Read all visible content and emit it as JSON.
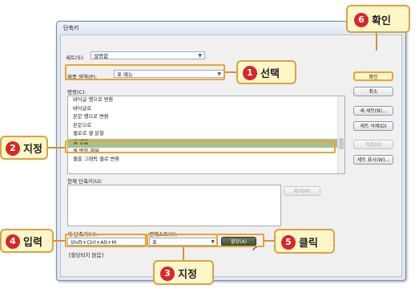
{
  "dialog": {
    "title": "단축키",
    "set_label": "세트(S):",
    "set_value": "설명합",
    "product_area_label": "제품 영역(P):",
    "product_area_value": "표 메뉴",
    "commands_label": "명령(C):",
    "commands": [
      "바닥글 행으로 변환",
      "바닥글로",
      "본문 행으로 변환",
      "본문으로",
      "셀로로 셀 분할",
      "셀 병합",
      "셀 병합 해제",
      "셀을 그래픽 셀로 변환"
    ],
    "selected_command_index": 5,
    "current_shortcut_label": "현재 단축키(U):",
    "remove_button": "제거(M)",
    "new_shortcut_label": "새 단축키(H):",
    "new_shortcut_value": "Shift+Ctrl+Alt+M",
    "context_label": "컨텍스트(X):",
    "context_value": "표",
    "assign_button": "할당(A)",
    "unassigned_text": "[할당되지 않음]",
    "buttons": {
      "ok": "확인",
      "cancel": "취소",
      "new_set": "새 세트(N)...",
      "delete_set": "세트 삭제(D)",
      "save": "저장(V)",
      "show_set": "세트 표시(W)..."
    }
  },
  "callouts": [
    {
      "num": "1",
      "text": "선택"
    },
    {
      "num": "2",
      "text": "지정"
    },
    {
      "num": "3",
      "text": "지정"
    },
    {
      "num": "4",
      "text": "입력"
    },
    {
      "num": "5",
      "text": "클릭"
    },
    {
      "num": "6",
      "text": "확인"
    }
  ],
  "colors": {
    "callout_border": "#d8a24a",
    "callout_fill": "#fdf7c8",
    "number_badge": "#d9262a",
    "selected_row": "#a7c08d"
  }
}
